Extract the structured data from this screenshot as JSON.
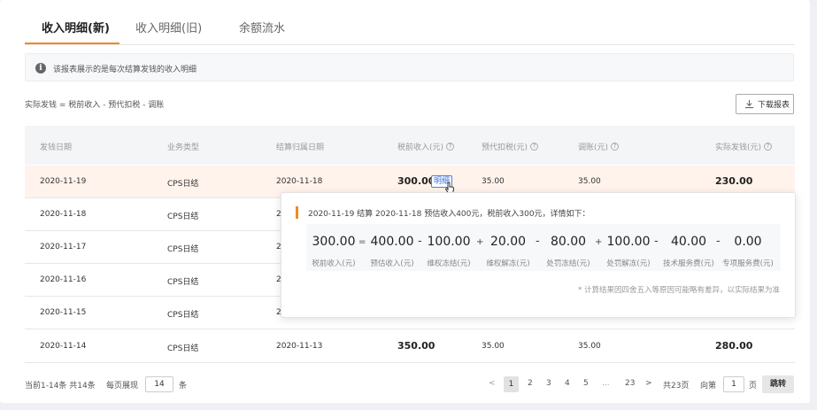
{
  "tabs": [
    "收入明细(新)",
    "收入明细(旧)",
    "余额流水"
  ],
  "notice": "该报表展示的是每次结算发钱的收入明细",
  "formula": "实际发钱 = 税前收入 - 预代扣税 - 调账",
  "download_label": "下载报表",
  "columns": [
    "发钱日期",
    "业务类型",
    "结算归属日期",
    "税前收入(元)",
    "预代扣税(元)",
    "调账(元)",
    "实际发钱(元)"
  ],
  "rows": [
    {
      "date": "2020-11-19",
      "type": "CPS日结",
      "settle": "2020-11-18",
      "pre": "300.00",
      "tax": "35.00",
      "adj": "35.00",
      "pay": "230.00"
    },
    {
      "date": "2020-11-18",
      "type": "CPS日结",
      "settle": "2",
      "pre": "",
      "tax": "",
      "adj": "",
      "pay": ""
    },
    {
      "date": "2020-11-17",
      "type": "CPS日结",
      "settle": "2",
      "pre": "",
      "tax": "",
      "adj": "",
      "pay": ""
    },
    {
      "date": "2020-11-16",
      "type": "CPS日结",
      "settle": "2",
      "pre": "",
      "tax": "",
      "adj": "",
      "pay": ""
    },
    {
      "date": "2020-11-15",
      "type": "CPS日结",
      "settle": "2",
      "pre": "",
      "tax": "",
      "adj": "",
      "pay": ""
    },
    {
      "date": "2020-11-14",
      "type": "CPS日结",
      "settle": "2020-11-13",
      "pre": "350.00",
      "tax": "35.00",
      "adj": "35.00",
      "pay": "280.00"
    }
  ],
  "detail_label": "明细",
  "popover": {
    "header": "2020-11-19 结算 2020-11-18 预估收入400元，税前收入300元，详情如下：",
    "items": [
      {
        "value": "300.00",
        "label": "税前收入(元)"
      },
      {
        "value": "400.00",
        "label": "预估收入(元)"
      },
      {
        "value": "100.00",
        "label": "维权冻结(元)"
      },
      {
        "value": "20.00",
        "label": "维权解冻(元)"
      },
      {
        "value": "80.00",
        "label": "处罚冻结(元)"
      },
      {
        "value": "100.00",
        "label": "处罚解冻(元)"
      },
      {
        "value": "40.00",
        "label": "技术服务费(元)"
      },
      {
        "value": "0.00",
        "label": "专项服务费(元)"
      }
    ],
    "ops": [
      "=",
      "-",
      "+",
      "-",
      "+",
      "-",
      "-"
    ],
    "note": "* 计算结果因四舍五入等原因可能略有差异，以实际结果为准"
  },
  "footer": {
    "summary": "当前1-14条 共14条",
    "per_page_label": "每页展现",
    "per_page": "14",
    "per_page_unit": "条",
    "pages": [
      "1",
      "2",
      "3",
      "4",
      "5",
      "...",
      "23"
    ],
    "prev": "<",
    "next": ">",
    "total_pages": "共23页",
    "goto_label": "向第",
    "goto_value": "1",
    "goto_unit": "页",
    "jump_label": "跳转"
  },
  "colors": {
    "accent": "#f08a24",
    "link": "#3a72e0",
    "highlight_row": "#fff3ec"
  }
}
